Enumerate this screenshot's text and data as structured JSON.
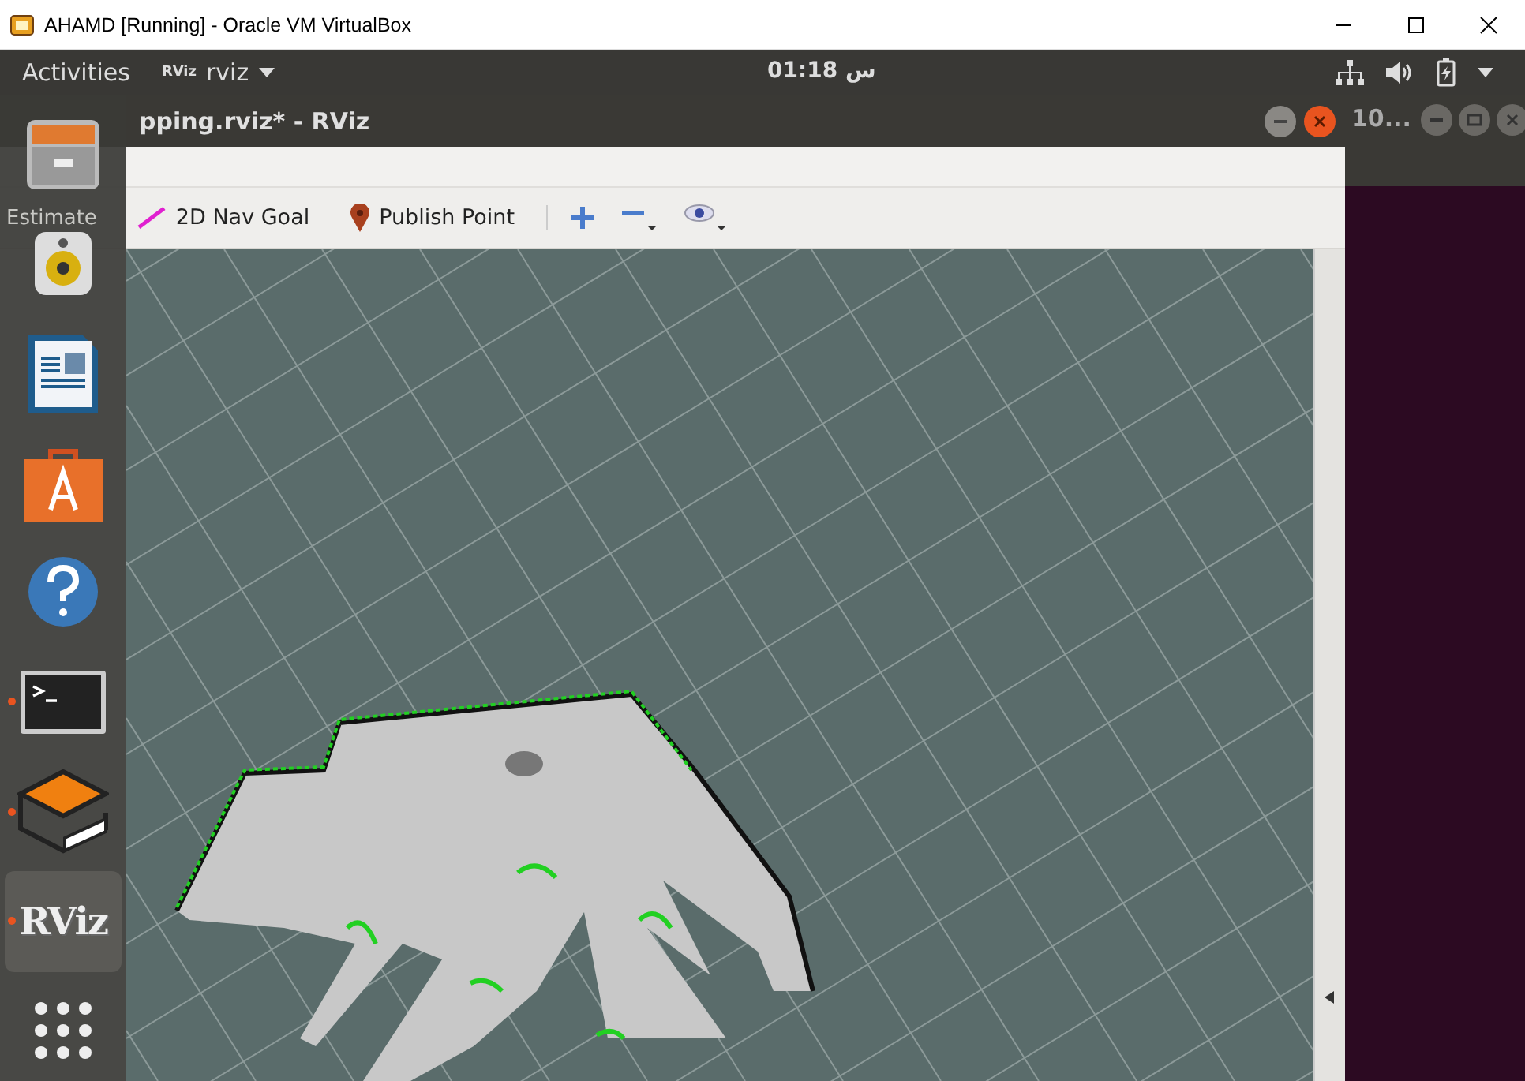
{
  "host_window": {
    "title": "AHAMD [Running] - Oracle VM VirtualBox"
  },
  "top_bar": {
    "activities": "Activities",
    "app_icon_text": "RViz",
    "app_name": "rviz",
    "clock": "01:18 س"
  },
  "rviz_window": {
    "title": "pping.rviz* - RViz",
    "toolbar": [
      {
        "kind": "text",
        "label": "Estimate"
      },
      {
        "kind": "nav-goal",
        "label": "2D Nav Goal"
      },
      {
        "kind": "publish-point",
        "label": "Publish Point"
      },
      {
        "kind": "zoom-in"
      },
      {
        "kind": "zoom-out"
      },
      {
        "kind": "view"
      }
    ]
  },
  "other_window": {
    "title": "10..."
  },
  "dock": [
    {
      "kind": "files",
      "running": false,
      "selected": false
    },
    {
      "kind": "speaker",
      "running": false,
      "selected": false
    },
    {
      "kind": "writer",
      "running": false,
      "selected": false
    },
    {
      "kind": "store",
      "running": false,
      "selected": false
    },
    {
      "kind": "help",
      "running": false,
      "selected": false
    },
    {
      "kind": "terminal",
      "running": true,
      "selected": false
    },
    {
      "kind": "box",
      "running": true,
      "selected": false
    },
    {
      "kind": "rviz",
      "label": "RViz",
      "running": true,
      "selected": true
    },
    {
      "kind": "apps",
      "running": false,
      "selected": false
    }
  ]
}
